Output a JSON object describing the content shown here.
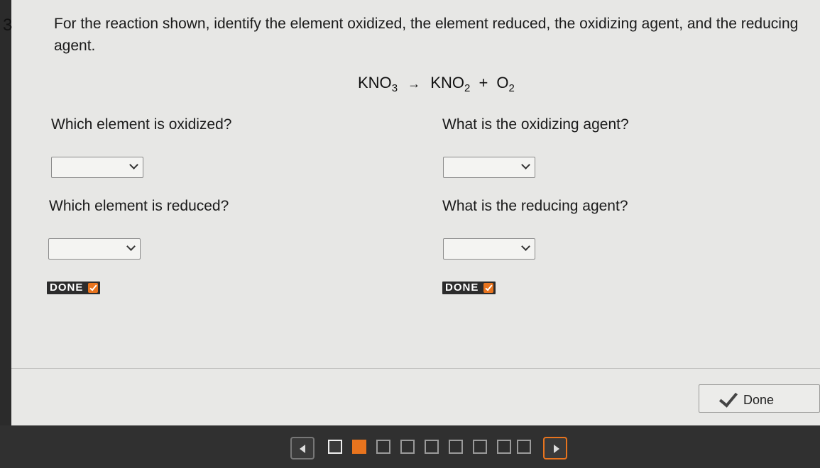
{
  "question": {
    "number": "3",
    "instruction": "For the reaction shown, identify the element oxidized, the element reduced, the oxidizing agent, and the reducing agent.",
    "equation": {
      "reactant": "KNO",
      "reactant_sub": "3",
      "arrow": "→",
      "product1": "KNO",
      "product1_sub": "2",
      "plus": "+",
      "product2": "O",
      "product2_sub": "2"
    }
  },
  "prompts": {
    "oxidized": "Which element is oxidized?",
    "oxidizing_agent": "What is the oxidizing agent?",
    "reduced": "Which element is reduced?",
    "reducing_agent": "What is the reducing agent?"
  },
  "selects": {
    "oxidized": "",
    "oxidizing_agent": "",
    "reduced": "",
    "reducing_agent": ""
  },
  "badges": {
    "left": "DONE",
    "right": "DONE"
  },
  "done_button": "Done",
  "colors": {
    "accent": "#e8741e"
  }
}
